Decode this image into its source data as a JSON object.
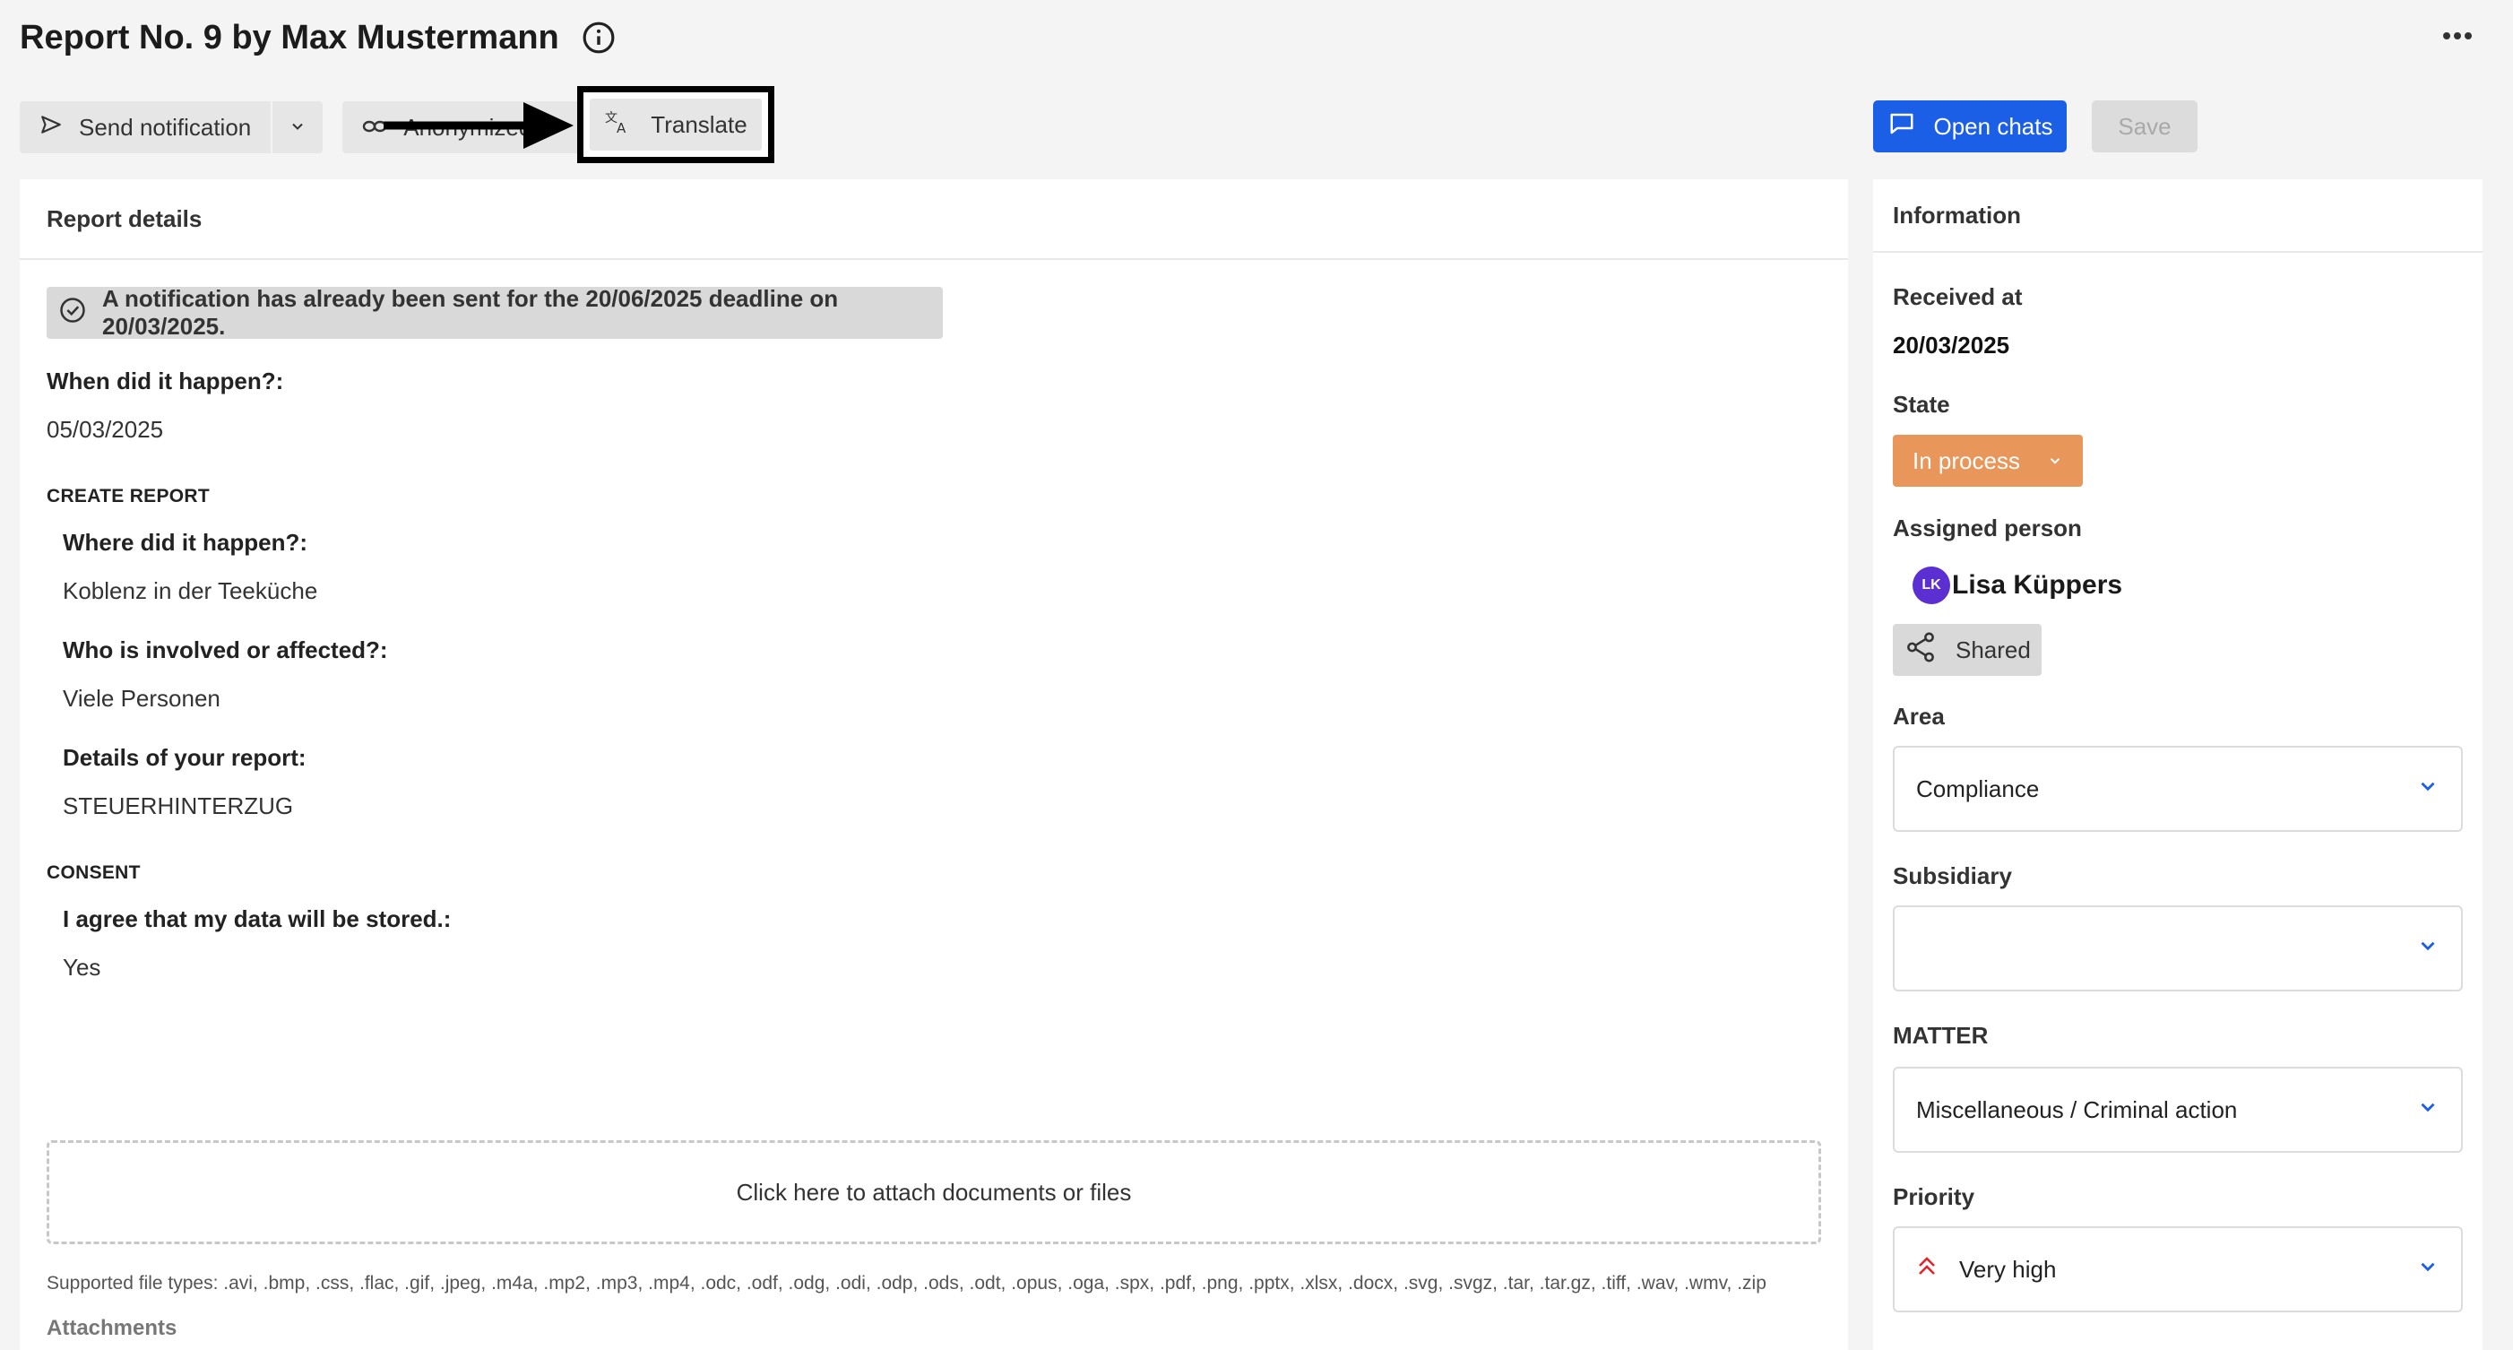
{
  "header": {
    "title": "Report No. 9 by Max Mustermann"
  },
  "toolbar": {
    "send_notification": "Send notification",
    "anonymized": "Anonymized v",
    "translate": "Translate",
    "open_chats": "Open chats",
    "save": "Save"
  },
  "report": {
    "panel_title": "Report details",
    "notice": "A notification has already been sent for the 20/06/2025 deadline on 20/03/2025.",
    "when_label": "When did it happen?:",
    "when_value": "05/03/2025",
    "section_create": "CREATE REPORT",
    "where_label": "Where did it happen?:",
    "where_value": "Koblenz in der Teeküche",
    "who_label": "Who is involved or affected?:",
    "who_value": "Viele Personen",
    "details_label": "Details of your report:",
    "details_value": "STEUERHINTERZUG",
    "section_consent": "CONSENT",
    "consent_label": "I agree that my data will be stored.:",
    "consent_value": "Yes",
    "dropzone": "Click here to attach documents or files",
    "supported_types": "Supported file types: .avi, .bmp, .css, .flac, .gif, .jpeg, .m4a, .mp2, .mp3, .mp4, .odc, .odf, .odg, .odi, .odp, .ods, .odt, .opus, .oga, .spx, .pdf, .png, .pptx, .xlsx, .docx, .svg, .svgz, .tar, .tar.gz, .tiff, .wav, .wmv, .zip",
    "attachments": "Attachments"
  },
  "info": {
    "panel_title": "Information",
    "received_label": "Received at",
    "received_value": "20/03/2025",
    "state_label": "State",
    "state_value": "In process",
    "assigned_label": "Assigned person",
    "assignee_initials": "LK",
    "assignee_name": "Lisa Küppers",
    "shared": "Shared",
    "area_label": "Area",
    "area_value": "Compliance",
    "subsidiary_label": "Subsidiary",
    "subsidiary_value": "",
    "matter_label": "MATTER",
    "matter_value": "Miscellaneous / Criminal action",
    "priority_label": "Priority",
    "priority_value": "Very high"
  },
  "colors": {
    "primary": "#1a5fe6",
    "state": "#e8965a",
    "avatar": "#5b2fd1",
    "priority_icon": "#e0262c"
  }
}
